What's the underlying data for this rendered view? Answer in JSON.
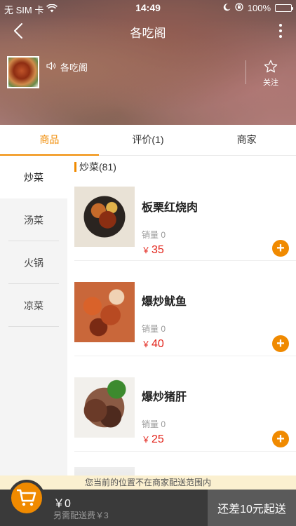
{
  "status_bar": {
    "carrier": "无 SIM 卡",
    "time": "14:49",
    "battery": "100%"
  },
  "navbar": {
    "title": "各吃阁"
  },
  "shop": {
    "name": "各吃阁",
    "follow_label": "关注"
  },
  "tabs": [
    {
      "label": "商品",
      "active": true
    },
    {
      "label": "评价(1)",
      "active": false
    },
    {
      "label": "商家",
      "active": false
    }
  ],
  "categories": [
    {
      "label": "炒菜",
      "active": true
    },
    {
      "label": "汤菜",
      "active": false
    },
    {
      "label": "火锅",
      "active": false
    },
    {
      "label": "凉菜",
      "active": false
    }
  ],
  "section": {
    "title": "炒菜(81)"
  },
  "items": [
    {
      "name": "板栗红烧肉",
      "sales": "销量 0",
      "currency": "￥",
      "price": "35"
    },
    {
      "name": "爆炒鱿鱼",
      "sales": "销量 0",
      "currency": "￥",
      "price": "40"
    },
    {
      "name": "爆炒猪肝",
      "sales": "销量 0",
      "currency": "￥",
      "price": "25"
    }
  ],
  "notice": "您当前的位置不在商家配送范围内",
  "cart": {
    "amount": "￥0",
    "fee": "另需配送费￥3",
    "checkout_label": "还差10元起送"
  },
  "colors": {
    "accent": "#f08a00",
    "price": "#e2231a",
    "cart_bar": "#3a3a3a"
  }
}
